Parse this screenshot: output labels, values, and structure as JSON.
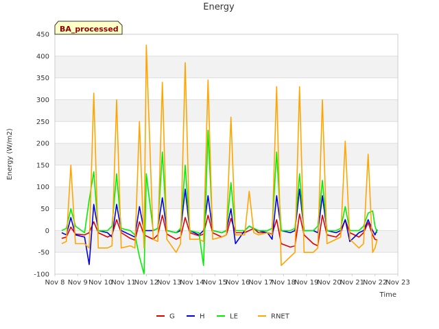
{
  "chart_data": {
    "type": "line",
    "title": "Energy",
    "xlabel": "Time",
    "ylabel": "Energy (W/m2)",
    "badge": "BA_processed",
    "ylim": [
      -100,
      450
    ],
    "yticks": [
      -100,
      -50,
      0,
      50,
      100,
      150,
      200,
      250,
      300,
      350,
      400,
      450
    ],
    "xlim": [
      8,
      23
    ],
    "xticks": [
      {
        "v": 8,
        "label": "Nov 8"
      },
      {
        "v": 9,
        "label": "Nov 9"
      },
      {
        "v": 10,
        "label": "Nov 10"
      },
      {
        "v": 11,
        "label": "Nov 11"
      },
      {
        "v": 12,
        "label": "Nov 12"
      },
      {
        "v": 13,
        "label": "Nov 13"
      },
      {
        "v": 14,
        "label": "Nov 14"
      },
      {
        "v": 15,
        "label": "Nov 15"
      },
      {
        "v": 16,
        "label": "Nov 16"
      },
      {
        "v": 17,
        "label": "Nov 17"
      },
      {
        "v": 18,
        "label": "Nov 18"
      },
      {
        "v": 19,
        "label": "Nov 19"
      },
      {
        "v": 20,
        "label": "Nov 20"
      },
      {
        "v": 21,
        "label": "Nov 21"
      },
      {
        "v": 22,
        "label": "Nov 22"
      },
      {
        "v": 23,
        "label": "Nov 23"
      }
    ],
    "grid": true,
    "legend_position": "bottom",
    "x_unit": "day of November",
    "series": [
      {
        "name": "G",
        "color": "#dd0000",
        "points": [
          [
            8.3,
            -18
          ],
          [
            8.5,
            -15
          ],
          [
            8.7,
            8
          ],
          [
            8.9,
            -8
          ],
          [
            9.3,
            -10
          ],
          [
            9.5,
            -5
          ],
          [
            9.7,
            20
          ],
          [
            9.9,
            -5
          ],
          [
            10.3,
            -15
          ],
          [
            10.5,
            -10
          ],
          [
            10.7,
            25
          ],
          [
            10.9,
            -5
          ],
          [
            11.3,
            -18
          ],
          [
            11.5,
            -22
          ],
          [
            11.7,
            20
          ],
          [
            11.9,
            -10
          ],
          [
            12.3,
            -20
          ],
          [
            12.5,
            -10
          ],
          [
            12.7,
            35
          ],
          [
            12.9,
            -8
          ],
          [
            13.3,
            -20
          ],
          [
            13.5,
            -15
          ],
          [
            13.7,
            30
          ],
          [
            13.9,
            -5
          ],
          [
            14.3,
            -12
          ],
          [
            14.5,
            -8
          ],
          [
            14.7,
            35
          ],
          [
            14.9,
            -5
          ],
          [
            15.3,
            -15
          ],
          [
            15.5,
            -10
          ],
          [
            15.7,
            28
          ],
          [
            15.9,
            -5
          ],
          [
            16.3,
            -5
          ],
          [
            16.5,
            0
          ],
          [
            16.7,
            5
          ],
          [
            16.9,
            -5
          ],
          [
            17.3,
            -5
          ],
          [
            17.5,
            -8
          ],
          [
            17.7,
            25
          ],
          [
            17.9,
            -30
          ],
          [
            18.3,
            -38
          ],
          [
            18.5,
            -35
          ],
          [
            18.7,
            38
          ],
          [
            18.9,
            -10
          ],
          [
            19.3,
            -30
          ],
          [
            19.5,
            -35
          ],
          [
            19.7,
            35
          ],
          [
            19.9,
            -10
          ],
          [
            20.3,
            -15
          ],
          [
            20.5,
            -5
          ],
          [
            20.7,
            25
          ],
          [
            20.9,
            -5
          ],
          [
            21.3,
            -15
          ],
          [
            21.5,
            -5
          ],
          [
            21.7,
            18
          ],
          [
            21.9,
            -10
          ],
          [
            22.0,
            -20
          ],
          [
            22.1,
            -22
          ]
        ]
      },
      {
        "name": "H",
        "color": "#0000dd",
        "points": [
          [
            8.3,
            -5
          ],
          [
            8.5,
            -10
          ],
          [
            8.7,
            30
          ],
          [
            8.9,
            -10
          ],
          [
            9.3,
            -15
          ],
          [
            9.5,
            -78
          ],
          [
            9.7,
            60
          ],
          [
            9.9,
            0
          ],
          [
            10.3,
            -5
          ],
          [
            10.5,
            -15
          ],
          [
            10.7,
            60
          ],
          [
            10.9,
            0
          ],
          [
            11.3,
            -10
          ],
          [
            11.5,
            -15
          ],
          [
            11.7,
            55
          ],
          [
            11.9,
            0
          ],
          [
            12.3,
            0
          ],
          [
            12.5,
            5
          ],
          [
            12.7,
            75
          ],
          [
            12.9,
            0
          ],
          [
            13.3,
            -5
          ],
          [
            13.5,
            0
          ],
          [
            13.7,
            95
          ],
          [
            13.9,
            0
          ],
          [
            14.3,
            -10
          ],
          [
            14.5,
            0
          ],
          [
            14.7,
            80
          ],
          [
            14.9,
            0
          ],
          [
            15.3,
            -5
          ],
          [
            15.5,
            0
          ],
          [
            15.7,
            50
          ],
          [
            15.9,
            -30
          ],
          [
            16.3,
            0
          ],
          [
            16.5,
            10
          ],
          [
            16.7,
            5
          ],
          [
            16.9,
            0
          ],
          [
            17.3,
            -5
          ],
          [
            17.5,
            -20
          ],
          [
            17.7,
            80
          ],
          [
            17.9,
            0
          ],
          [
            18.3,
            -5
          ],
          [
            18.5,
            0
          ],
          [
            18.7,
            95
          ],
          [
            18.9,
            0
          ],
          [
            19.3,
            0
          ],
          [
            19.5,
            -5
          ],
          [
            19.7,
            80
          ],
          [
            19.9,
            0
          ],
          [
            20.3,
            -5
          ],
          [
            20.5,
            0
          ],
          [
            20.7,
            25
          ],
          [
            20.9,
            -25
          ],
          [
            21.3,
            -5
          ],
          [
            21.5,
            0
          ],
          [
            21.7,
            25
          ],
          [
            21.9,
            0
          ],
          [
            22.0,
            -10
          ],
          [
            22.1,
            2
          ]
        ]
      },
      {
        "name": "LE",
        "color": "#00ee00",
        "points": [
          [
            8.3,
            0
          ],
          [
            8.5,
            5
          ],
          [
            8.7,
            50
          ],
          [
            8.9,
            10
          ],
          [
            9.3,
            -5
          ],
          [
            9.5,
            70
          ],
          [
            9.7,
            135
          ],
          [
            9.9,
            0
          ],
          [
            10.3,
            0
          ],
          [
            10.5,
            10
          ],
          [
            10.7,
            130
          ],
          [
            10.9,
            5
          ],
          [
            11.3,
            0
          ],
          [
            11.5,
            -10
          ],
          [
            11.7,
            -60
          ],
          [
            11.9,
            -100
          ],
          [
            12.0,
            130
          ],
          [
            12.3,
            0
          ],
          [
            12.5,
            5
          ],
          [
            12.7,
            180
          ],
          [
            12.9,
            0
          ],
          [
            13.3,
            -5
          ],
          [
            13.5,
            5
          ],
          [
            13.7,
            150
          ],
          [
            13.9,
            0
          ],
          [
            14.3,
            -5
          ],
          [
            14.5,
            -80
          ],
          [
            14.7,
            230
          ],
          [
            14.9,
            0
          ],
          [
            15.3,
            -5
          ],
          [
            15.5,
            0
          ],
          [
            15.7,
            110
          ],
          [
            15.9,
            0
          ],
          [
            16.3,
            0
          ],
          [
            16.5,
            10
          ],
          [
            16.7,
            5
          ],
          [
            16.9,
            0
          ],
          [
            17.3,
            0
          ],
          [
            17.5,
            5
          ],
          [
            17.7,
            180
          ],
          [
            17.9,
            0
          ],
          [
            18.3,
            0
          ],
          [
            18.5,
            5
          ],
          [
            18.7,
            130
          ],
          [
            18.9,
            0
          ],
          [
            19.3,
            0
          ],
          [
            19.5,
            10
          ],
          [
            19.7,
            115
          ],
          [
            19.9,
            0
          ],
          [
            20.3,
            0
          ],
          [
            20.5,
            5
          ],
          [
            20.7,
            55
          ],
          [
            20.9,
            0
          ],
          [
            21.3,
            0
          ],
          [
            21.5,
            10
          ],
          [
            21.7,
            40
          ],
          [
            21.9,
            45
          ],
          [
            22.0,
            10
          ],
          [
            22.1,
            -5
          ]
        ]
      },
      {
        "name": "RNET",
        "color": "#ffa500",
        "points": [
          [
            8.3,
            -30
          ],
          [
            8.5,
            -25
          ],
          [
            8.7,
            150
          ],
          [
            8.9,
            -30
          ],
          [
            9.3,
            -30
          ],
          [
            9.5,
            -40
          ],
          [
            9.7,
            315
          ],
          [
            9.9,
            -40
          ],
          [
            10.3,
            -40
          ],
          [
            10.5,
            -35
          ],
          [
            10.7,
            300
          ],
          [
            10.9,
            -40
          ],
          [
            11.3,
            -35
          ],
          [
            11.5,
            -40
          ],
          [
            11.7,
            250
          ],
          [
            11.9,
            -40
          ],
          [
            12.0,
            425
          ],
          [
            12.3,
            -20
          ],
          [
            12.5,
            -25
          ],
          [
            12.7,
            340
          ],
          [
            12.9,
            -20
          ],
          [
            13.3,
            -50
          ],
          [
            13.5,
            -30
          ],
          [
            13.7,
            385
          ],
          [
            13.9,
            -20
          ],
          [
            14.3,
            -20
          ],
          [
            14.5,
            -25
          ],
          [
            14.7,
            345
          ],
          [
            14.9,
            -20
          ],
          [
            15.3,
            -15
          ],
          [
            15.5,
            -10
          ],
          [
            15.7,
            260
          ],
          [
            15.9,
            -10
          ],
          [
            16.3,
            -10
          ],
          [
            16.5,
            90
          ],
          [
            16.7,
            -5
          ],
          [
            16.9,
            -10
          ],
          [
            17.3,
            -5
          ],
          [
            17.5,
            -10
          ],
          [
            17.7,
            330
          ],
          [
            17.9,
            -80
          ],
          [
            18.3,
            -60
          ],
          [
            18.5,
            -50
          ],
          [
            18.7,
            330
          ],
          [
            18.9,
            -50
          ],
          [
            19.3,
            -50
          ],
          [
            19.5,
            -40
          ],
          [
            19.7,
            300
          ],
          [
            19.9,
            -30
          ],
          [
            20.3,
            -20
          ],
          [
            20.5,
            -15
          ],
          [
            20.7,
            205
          ],
          [
            20.9,
            -20
          ],
          [
            21.3,
            -40
          ],
          [
            21.5,
            -30
          ],
          [
            21.7,
            175
          ],
          [
            21.9,
            -50
          ],
          [
            22.0,
            -40
          ],
          [
            22.1,
            -20
          ]
        ]
      }
    ]
  }
}
